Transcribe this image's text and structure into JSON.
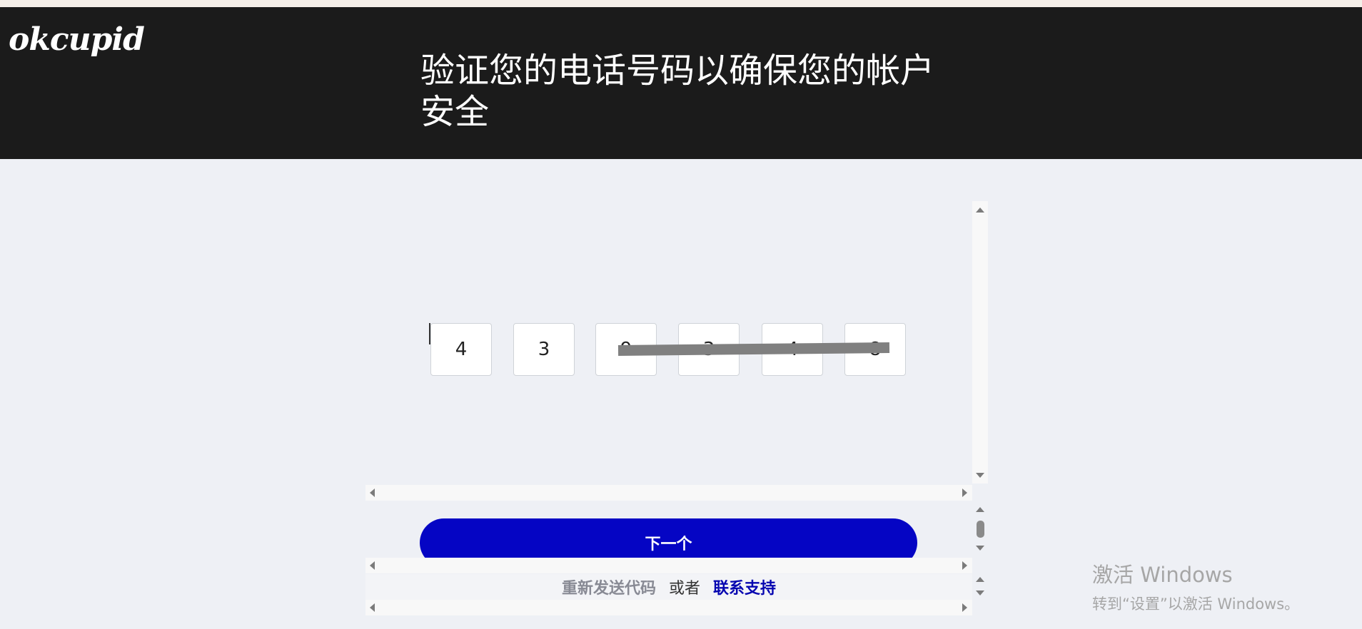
{
  "header": {
    "logo_text": "okcupid",
    "title": "验证您的电话号码以确保您的帐户安全"
  },
  "code_inputs": [
    {
      "value": "4"
    },
    {
      "value": "3"
    },
    {
      "value": "9"
    },
    {
      "value": "3"
    },
    {
      "value": "4"
    },
    {
      "value": "8"
    }
  ],
  "next_button": {
    "label": "下一个"
  },
  "links": {
    "resend": "重新发送代码",
    "or": "或者",
    "support": "联系支持"
  },
  "watermark": {
    "line1": "激活 Windows",
    "line2": "转到“设置”以激活 Windows。"
  },
  "colors": {
    "header_bg": "#1b1b1b",
    "page_bg": "#eef0f5",
    "primary_button": "#0505c4",
    "support_link": "#0505b0"
  }
}
